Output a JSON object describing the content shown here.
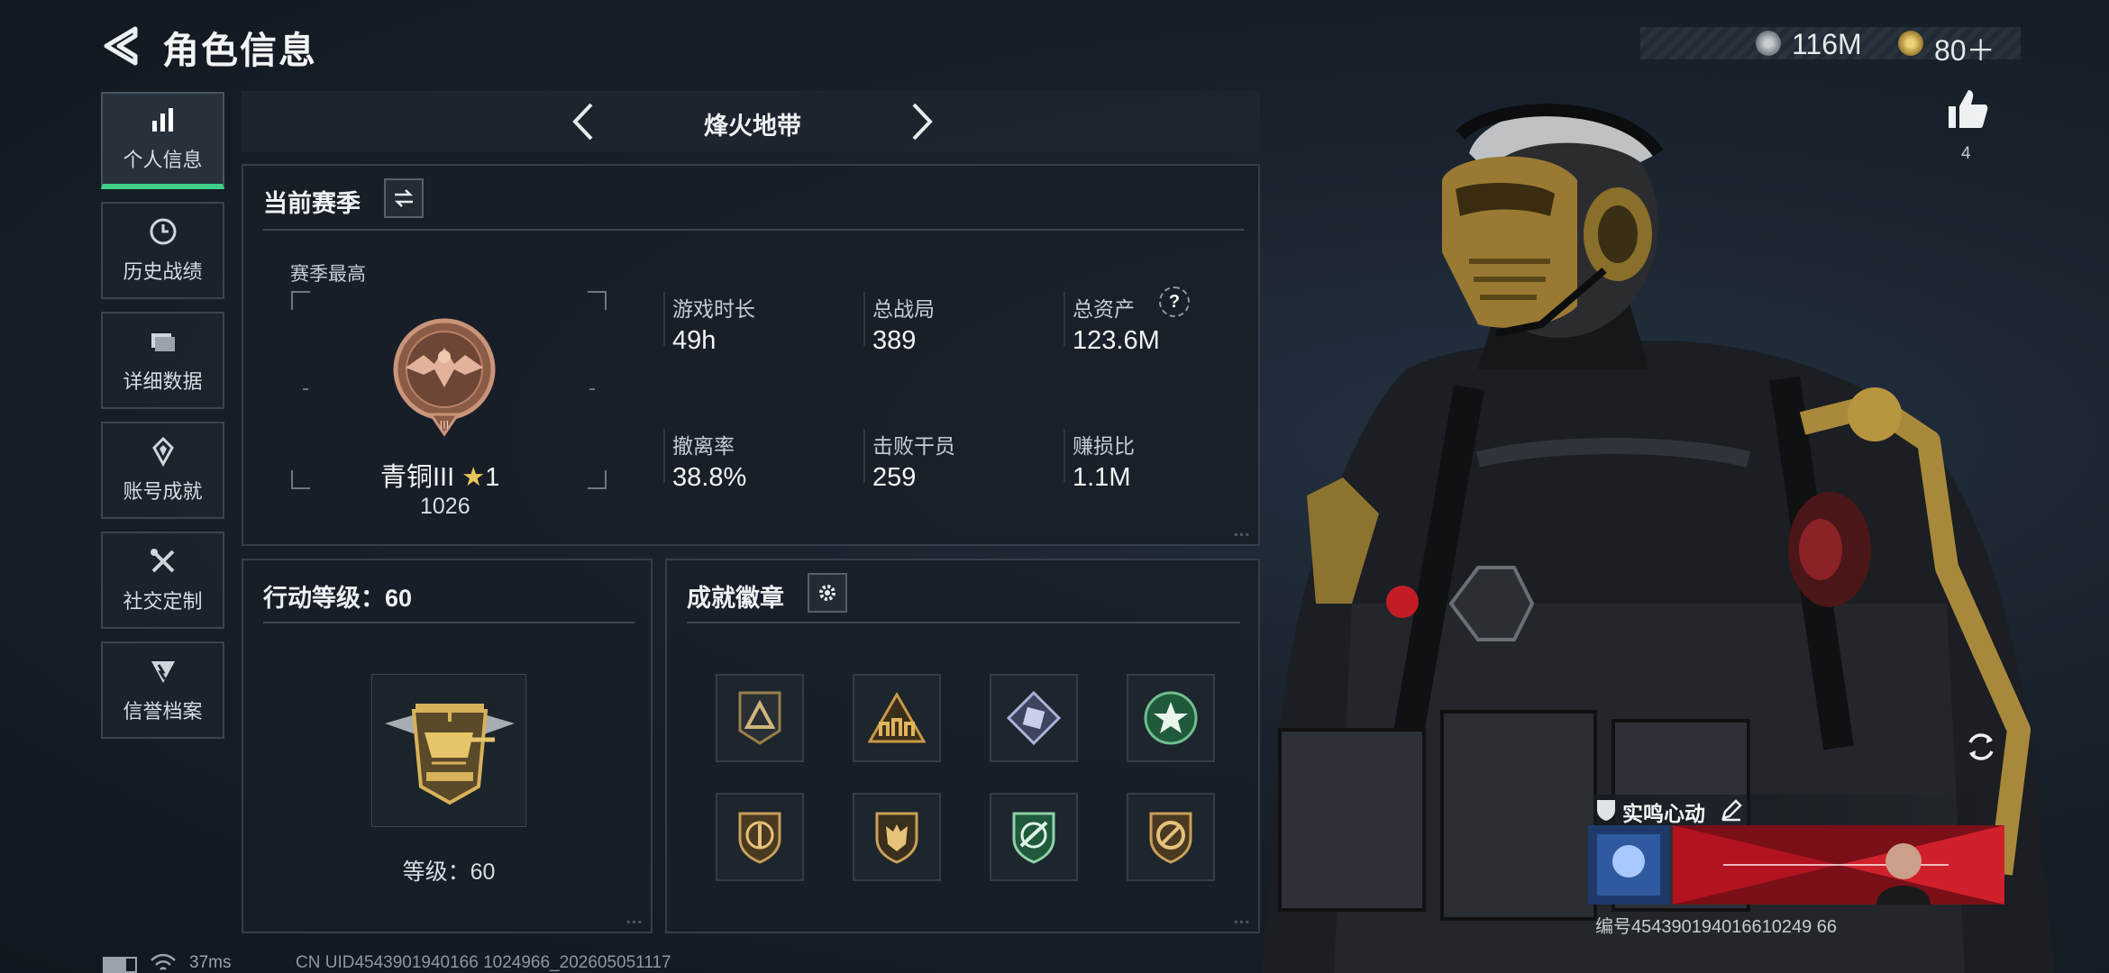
{
  "header": {
    "title": "角色信息",
    "currency": [
      {
        "icon": "silver-coin-icon",
        "value": "116M"
      },
      {
        "icon": "gold-coin-icon",
        "value": "80＋"
      }
    ]
  },
  "sidebar": {
    "items": [
      {
        "label": "个人信息",
        "icon": "bar-chart-icon",
        "active": true
      },
      {
        "label": "历史战绩",
        "icon": "clock-icon"
      },
      {
        "label": "详细数据",
        "icon": "folder-icon"
      },
      {
        "label": "账号成就",
        "icon": "achievement-icon"
      },
      {
        "label": "社交定制",
        "icon": "tools-icon"
      },
      {
        "label": "信誉档案",
        "icon": "credit-icon"
      }
    ]
  },
  "map": {
    "name": "烽火地带"
  },
  "season": {
    "title": "当前赛季",
    "best_label": "赛季最高",
    "rank_name": "青铜III",
    "rank_stars": "1",
    "rank_points": "1026",
    "stats": [
      {
        "label": "游戏时长",
        "value": "49h"
      },
      {
        "label": "总战局",
        "value": "389"
      },
      {
        "label": "总资产",
        "value": "123.6M"
      },
      {
        "label": "撤离率",
        "value": "38.8%"
      },
      {
        "label": "击败干员",
        "value": "259"
      },
      {
        "label": "赚损比",
        "value": "1.1M"
      }
    ],
    "help_mark": "?"
  },
  "action_level": {
    "title": "行动等级：60",
    "level_text": "等级：60"
  },
  "achievements": {
    "title": "成就徽章",
    "badges": [
      {
        "icon": "triangle-badge-icon"
      },
      {
        "icon": "squad-badge-icon"
      },
      {
        "icon": "diamond-badge-icon"
      },
      {
        "icon": "star-wreath-badge-icon"
      },
      {
        "icon": "shield-knife-badge-icon"
      },
      {
        "icon": "shield-beast-badge-icon"
      },
      {
        "icon": "shield-rifle-badge-icon"
      },
      {
        "icon": "shield-ban-badge-icon"
      }
    ]
  },
  "profile": {
    "likes": "4",
    "card_name": "实鸣心动",
    "card_id": "编号454390194016610249 66"
  },
  "footer": {
    "ping": "37ms",
    "uid": "CN UID4543901940166 1024966_202605051117"
  },
  "colors": {
    "accent": "#3fd08a",
    "bronze": "#b07a5c",
    "gold": "#c9a24a"
  }
}
